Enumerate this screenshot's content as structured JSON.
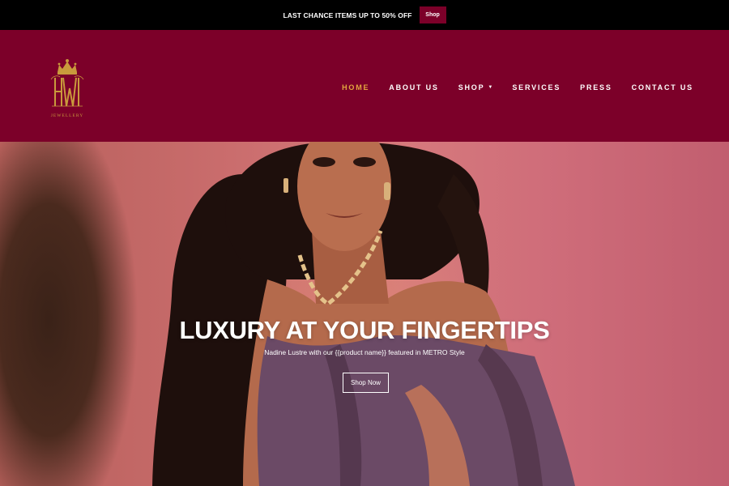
{
  "announcement": {
    "text": "LAST CHANCE ITEMS UP TO 50% OFF",
    "button_label": "Shop",
    "accent_color": "#7c0029"
  },
  "header": {
    "background_color": "#7c0029",
    "logo": {
      "subtext": "JEWELLERY",
      "monogram": "HW",
      "gold_color": "#c99a3c"
    },
    "nav": [
      {
        "label": "HOME",
        "active": true
      },
      {
        "label": "ABOUT US",
        "active": false
      },
      {
        "label": "SHOP",
        "active": false,
        "has_dropdown": true
      },
      {
        "label": "SERVICES",
        "active": false
      },
      {
        "label": "PRESS",
        "active": false
      },
      {
        "label": "CONTACT US",
        "active": false
      }
    ],
    "active_color": "#e3a63f"
  },
  "hero": {
    "title": "LUXURY AT YOUR FINGERTIPS",
    "subtitle": "Nadine Lustre with our {{product name}} featured in METRO Style",
    "button_label": "Shop Now"
  }
}
